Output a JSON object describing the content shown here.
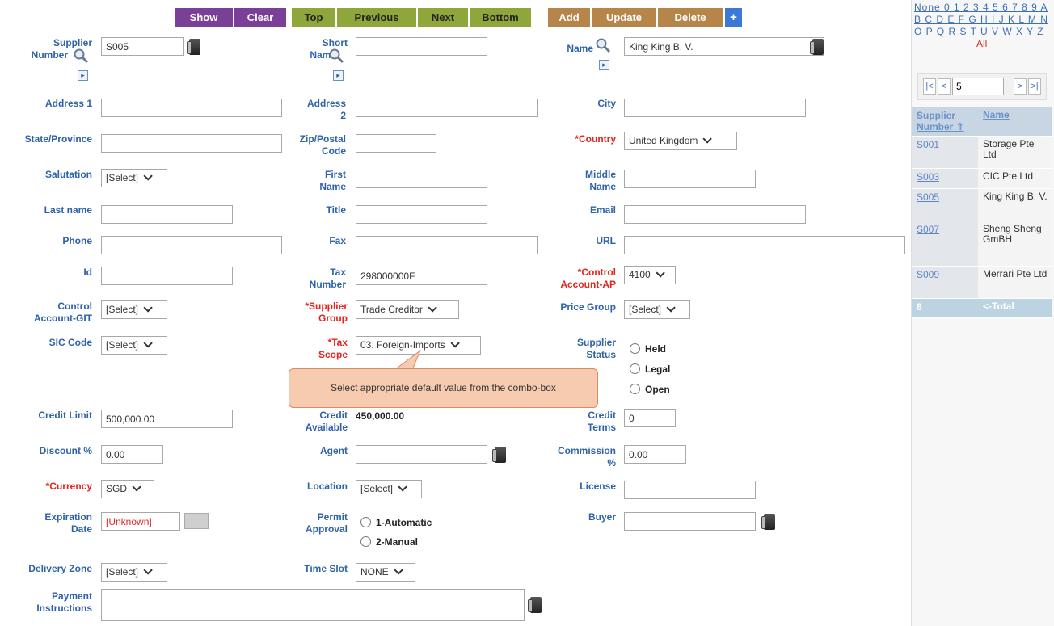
{
  "toolbar": {
    "show": "Show",
    "clear": "Clear",
    "top": "Top",
    "previous": "Previous",
    "next": "Next",
    "bottom": "Bottom",
    "add": "Add",
    "update": "Update",
    "delete": "Delete",
    "plus": "+"
  },
  "labels": {
    "supplier_number_1": "Supplier",
    "supplier_number_2": "Number",
    "short_name_1": "Short",
    "short_name_2": "Name",
    "name": "Name",
    "address1": "Address 1",
    "address2_1": "Address",
    "address2_2": "2",
    "city": "City",
    "state": "State/Province",
    "zip_1": "Zip/Postal",
    "zip_2": "Code",
    "country": "*Country",
    "salutation": "Salutation",
    "first_1": "First",
    "first_2": "Name",
    "middle_1": "Middle",
    "middle_2": "Name",
    "last": "Last name",
    "title": "Title",
    "email": "Email",
    "phone": "Phone",
    "fax": "Fax",
    "url": "URL",
    "id": "Id",
    "tax_1": "Tax",
    "tax_2": "Number",
    "ctrl_ap_1": "*Control",
    "ctrl_ap_2": "Account-AP",
    "ctrl_git_1": "Control",
    "ctrl_git_2": "Account-GIT",
    "supgroup_1": "*Supplier",
    "supgroup_2": "Group",
    "price_group": "Price Group",
    "sic": "SIC Code",
    "taxscope_1": "*Tax",
    "taxscope_2": "Scope",
    "supstatus_1": "Supplier",
    "supstatus_2": "Status",
    "credit_limit": "Credit Limit",
    "credit_avail_1": "Credit",
    "credit_avail_2": "Available",
    "credit_terms_1": "Credit",
    "credit_terms_2": "Terms",
    "discount": "Discount %",
    "agent": "Agent",
    "commission_1": "Commission",
    "commission_2": "%",
    "currency": "*Currency",
    "location": "Location",
    "license": "License",
    "expiration_1": "Expiration",
    "expiration_2": "Date",
    "permit_1": "Permit",
    "permit_2": "Approval",
    "buyer": "Buyer",
    "delivery_zone": "Delivery Zone",
    "time_slot": "Time Slot",
    "payment_1": "Payment",
    "payment_2": "Instructions"
  },
  "values": {
    "supplier_number": "S005",
    "short_name": "",
    "name": "King King B. V.",
    "address1": "",
    "address2": "",
    "city": "",
    "state": "",
    "zip": "",
    "country": "United Kingdom",
    "salutation": "[Select]",
    "first_name": "",
    "middle_name": "",
    "last_name": "",
    "title": "",
    "email": "",
    "phone": "",
    "fax": "",
    "url": "",
    "id": "",
    "tax_number": "298000000F",
    "ctrl_ap": "4100",
    "ctrl_git": "[Select]",
    "supplier_group": "Trade Creditor",
    "price_group": "[Select]",
    "sic_code": "[Select]",
    "tax_scope": "03. Foreign-Imports",
    "status_held": "Held",
    "status_legal": "Legal",
    "status_open": "Open",
    "credit_limit": "500,000.00",
    "credit_available": "450,000.00",
    "credit_terms": "0",
    "discount": "0.00",
    "agent": "",
    "commission": "0.00",
    "currency": "SGD",
    "location": "[Select]",
    "license": "",
    "expiration": "[Unknown]",
    "permit_auto": "1-Automatic",
    "permit_manual": "2-Manual",
    "buyer": "",
    "delivery_zone": "[Select]",
    "time_slot": "NONE",
    "payment": ""
  },
  "tooltip": "Select appropriate default value from the combo-box",
  "sidebar": {
    "alpha_row1": "None 0 1 2 3 4 5 6 7 8 9 A",
    "alpha_row2": "B C D E F G H I J K L M N",
    "alpha_row3": "O P Q R S T U V W X Y Z",
    "all": "All",
    "pager": {
      "first": "|<",
      "prev": "<",
      "page_size": "5",
      "next": ">",
      "last": ">|"
    },
    "col_supplier": "Supplier Number",
    "sort_arrow": "⇑",
    "col_name": "Name",
    "rows": [
      {
        "code": "S001",
        "name": "Storage Pte Ltd"
      },
      {
        "code": "S003",
        "name": "CIC Pte Ltd"
      },
      {
        "code": "S005",
        "name": "King King B. V."
      },
      {
        "code": "S007",
        "name": "Sheng Sheng GmBH"
      },
      {
        "code": "S009",
        "name": "Merrari Pte Ltd"
      }
    ],
    "total_count": "8",
    "total_label": "<-Total"
  },
  "colors": {
    "label": "#2f63a8",
    "required": "#e0261e",
    "purple": "#7a3f97",
    "olive": "#8fa63a",
    "brown": "#b5854a",
    "blue": "#3c78d8"
  }
}
